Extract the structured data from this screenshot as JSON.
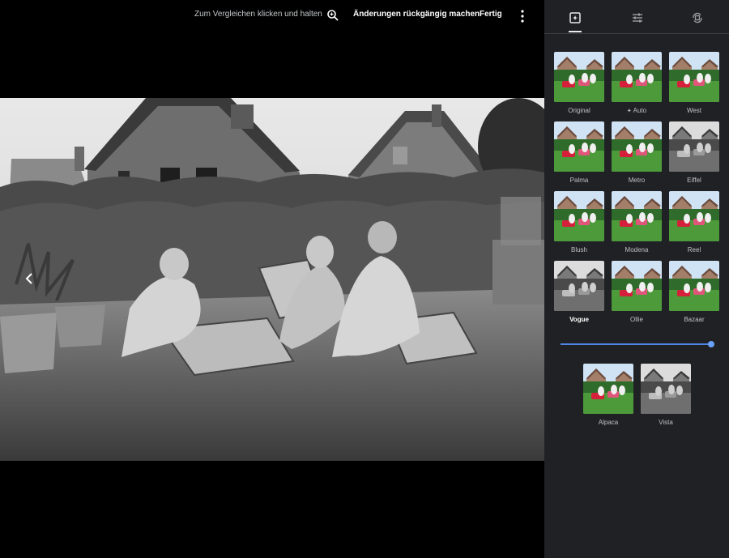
{
  "toolbar": {
    "compare_label": "Zum Vergleichen klicken und halten",
    "zoom_icon": "zoom-in-icon",
    "undo_label": "Änderungen rückgängig machen",
    "done_label": "Fertig",
    "more_icon": "more-vertical-icon"
  },
  "panel": {
    "tabs": [
      {
        "name": "filters",
        "icon": "filters-icon",
        "active": true
      },
      {
        "name": "adjust",
        "icon": "adjust-sliders-icon",
        "active": false
      },
      {
        "name": "crop-rotate",
        "icon": "crop-rotate-icon",
        "active": false
      }
    ],
    "filters": [
      {
        "label": "Original",
        "style": "color",
        "selected": false
      },
      {
        "label": "Auto",
        "style": "color",
        "selected": false,
        "icon": "auto-sparkle-icon"
      },
      {
        "label": "West",
        "style": "color",
        "selected": false
      },
      {
        "label": "Palma",
        "style": "color",
        "selected": false
      },
      {
        "label": "Metro",
        "style": "color",
        "selected": false
      },
      {
        "label": "Eiffel",
        "style": "mono",
        "selected": false
      },
      {
        "label": "Blush",
        "style": "color",
        "selected": false
      },
      {
        "label": "Modena",
        "style": "color",
        "selected": false
      },
      {
        "label": "Reel",
        "style": "color",
        "selected": false
      },
      {
        "label": "Vogue",
        "style": "mono",
        "selected": true
      },
      {
        "label": "Ollie",
        "style": "color",
        "selected": false
      },
      {
        "label": "Bazaar",
        "style": "color",
        "selected": false
      },
      {
        "label": "Alpaca",
        "style": "color",
        "selected": false
      },
      {
        "label": "Vista",
        "style": "mono",
        "selected": false
      }
    ],
    "intensity": 1.0
  },
  "colors": {
    "panel_bg": "#202124",
    "accent": "#4f86e6"
  }
}
